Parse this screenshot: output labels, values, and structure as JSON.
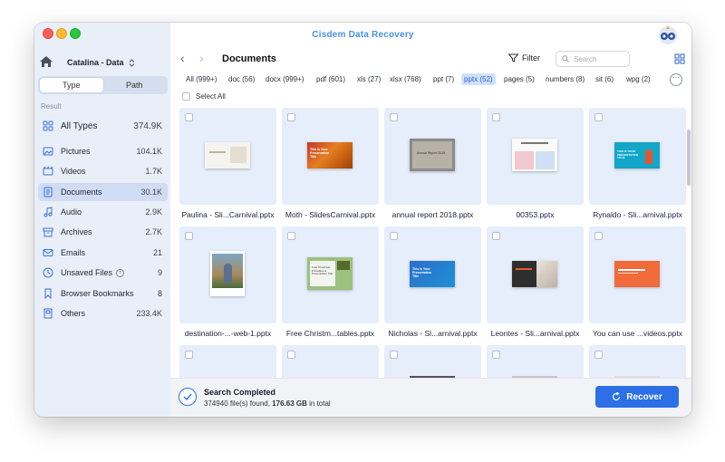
{
  "app": {
    "title": "Cisdem Data Recovery"
  },
  "sidebar": {
    "drive": "Catalina - Data",
    "segments": [
      "Type",
      "Path"
    ],
    "result_label": "Result",
    "categories": [
      {
        "label": "All Types",
        "count": "374.9K",
        "icon": "grid-icon"
      },
      {
        "label": "Pictures",
        "count": "104.1K",
        "icon": "image-icon"
      },
      {
        "label": "Videos",
        "count": "1.7K",
        "icon": "video-icon"
      },
      {
        "label": "Documents",
        "count": "30.1K",
        "icon": "document-icon"
      },
      {
        "label": "Audio",
        "count": "2.9K",
        "icon": "music-icon"
      },
      {
        "label": "Archives",
        "count": "2.7K",
        "icon": "archive-icon"
      },
      {
        "label": "Emails",
        "count": "21",
        "icon": "mail-icon"
      },
      {
        "label": "Unsaved Files",
        "count": "9",
        "icon": "clock-icon"
      },
      {
        "label": "Browser Bookmarks",
        "count": "8",
        "icon": "bookmark-icon"
      },
      {
        "label": "Others",
        "count": "233.4K",
        "icon": "box-icon"
      }
    ]
  },
  "toolbar": {
    "title": "Documents",
    "filter_label": "Filter",
    "search_placeholder": "Search"
  },
  "filter_tabs": [
    "All (999+)",
    "doc (56)",
    "docx (999+)",
    "pdf (601)",
    "xls (27)",
    "xlsx (768)",
    "ppt (7)",
    "pptx (52)",
    "pages (5)",
    "numbers (8)",
    "sit (6)",
    "wpg (2)"
  ],
  "selected_tab": "pptx (52)",
  "select_all_label": "Select All",
  "files": [
    {
      "name": "Paulina - Sli...Carnival.pptx"
    },
    {
      "name": "Moth - SlidesCarnival.pptx"
    },
    {
      "name": "annual report 2018.pptx"
    },
    {
      "name": "00353.pptx"
    },
    {
      "name": "Rynaldo - Sli...arnival.pptx"
    },
    {
      "name": "destination-...-web-1.pptx"
    },
    {
      "name": "Free Christm...tables.pptx"
    },
    {
      "name": "Nicholas - Sl...arnival.pptx"
    },
    {
      "name": "Leontes - Sli...arnival.pptx"
    },
    {
      "name": "You can use ...videos.pptx"
    }
  ],
  "thumb_text": {
    "moth": "This is Your Presentation Title",
    "report": "Annual Report 2018",
    "rynaldo": "THIS IS YOUR PRESENTATION TITLE",
    "christmas": "Free Christmas Printables & Presentation Title",
    "nicholas": "This is Your Presentation Title"
  },
  "footer": {
    "status_title": "Search Completed",
    "found_count": "374940",
    "found_text": " file(s) found, ",
    "total_size": "176.63 GB",
    "total_text": " in total",
    "recover_label": "Recover"
  },
  "colors": {
    "accent": "#2c6fe6",
    "sidebar_bg": "#e9eff9",
    "selected_tab": "#cfe0fb"
  }
}
